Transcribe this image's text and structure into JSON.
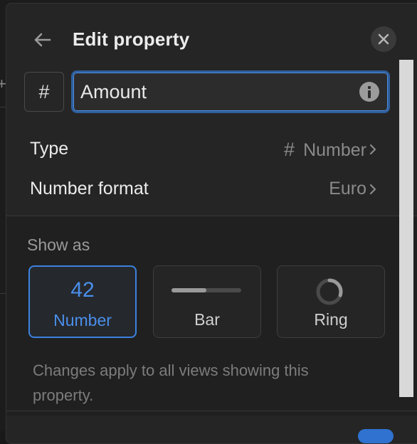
{
  "header": {
    "title": "Edit property",
    "back_icon": "arrow-left-icon",
    "close_icon": "close-icon"
  },
  "name_field": {
    "type_glyph": "#",
    "value": "Amount",
    "info_icon": "info-icon"
  },
  "rows": {
    "type": {
      "label": "Type",
      "glyph": "#",
      "value": "Number"
    },
    "format": {
      "label": "Number format",
      "value": "Euro"
    }
  },
  "show_as": {
    "heading": "Show as",
    "selected": "number",
    "options": {
      "number": {
        "preview": "42",
        "label": "Number"
      },
      "bar": {
        "label": "Bar",
        "fill_fraction": 0.5
      },
      "ring": {
        "label": "Ring",
        "fill_fraction": 0.3
      }
    },
    "note": "Changes apply to all views showing this property."
  },
  "colors": {
    "accent": "#3c82e0",
    "panel": "#252525",
    "text": "#ececec",
    "muted": "#8a8a8a"
  }
}
